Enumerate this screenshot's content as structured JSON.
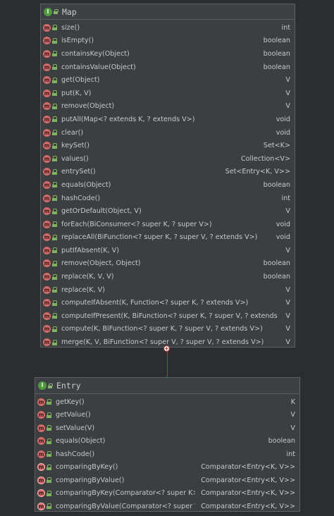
{
  "map": {
    "title": "Map",
    "header_icon": "I",
    "methods": [
      {
        "sig": "size()",
        "ret": "int"
      },
      {
        "sig": "isEmpty()",
        "ret": "boolean"
      },
      {
        "sig": "containsKey(Object)",
        "ret": "boolean"
      },
      {
        "sig": "containsValue(Object)",
        "ret": "boolean"
      },
      {
        "sig": "get(Object)",
        "ret": "V"
      },
      {
        "sig": "put(K, V)",
        "ret": "V"
      },
      {
        "sig": "remove(Object)",
        "ret": "V"
      },
      {
        "sig": "putAll(Map<? extends K, ? extends V>)",
        "ret": "void"
      },
      {
        "sig": "clear()",
        "ret": "void"
      },
      {
        "sig": "keySet()",
        "ret": "Set<K>"
      },
      {
        "sig": "values()",
        "ret": "Collection<V>"
      },
      {
        "sig": "entrySet()",
        "ret": "Set<Entry<K, V>>"
      },
      {
        "sig": "equals(Object)",
        "ret": "boolean"
      },
      {
        "sig": "hashCode()",
        "ret": "int"
      },
      {
        "sig": "getOrDefault(Object, V)",
        "ret": "V"
      },
      {
        "sig": "forEach(BiConsumer<? super K, ? super V>)",
        "ret": "void"
      },
      {
        "sig": "replaceAll(BiFunction<? super K, ? super V, ? extends V>)",
        "ret": "void"
      },
      {
        "sig": "putIfAbsent(K, V)",
        "ret": "V"
      },
      {
        "sig": "remove(Object, Object)",
        "ret": "boolean"
      },
      {
        "sig": "replace(K, V, V)",
        "ret": "boolean"
      },
      {
        "sig": "replace(K, V)",
        "ret": "V"
      },
      {
        "sig": "computeIfAbsent(K, Function<? super K, ? extends V>)",
        "ret": "V"
      },
      {
        "sig": "computeIfPresent(K, BiFunction<? super K, ? super V, ? extends V>)",
        "ret": "V"
      },
      {
        "sig": "compute(K, BiFunction<? super K, ? super V, ? extends V>)",
        "ret": "V"
      },
      {
        "sig": "merge(K, V, BiFunction<? super V, ? super V, ? extends V>)",
        "ret": "V"
      }
    ]
  },
  "entry": {
    "title": "Entry",
    "header_icon": "I",
    "methods": [
      {
        "sig": "getKey()",
        "ret": "K"
      },
      {
        "sig": "getValue()",
        "ret": "V"
      },
      {
        "sig": "setValue(V)",
        "ret": "V"
      },
      {
        "sig": "equals(Object)",
        "ret": "boolean"
      },
      {
        "sig": "hashCode()",
        "ret": "int"
      },
      {
        "sig": "comparingByKey()",
        "ret": "Comparator<Entry<K, V>>",
        "static": true
      },
      {
        "sig": "comparingByValue()",
        "ret": "Comparator<Entry<K, V>>",
        "static": true
      },
      {
        "sig": "comparingByKey(Comparator<? super K>)",
        "ret": "Comparator<Entry<K, V>>",
        "static": true
      },
      {
        "sig": "comparingByValue(Comparator<? super V>)",
        "ret": "Comparator<Entry<K, V>>",
        "static": true
      }
    ]
  },
  "method_icon": "m",
  "colors": {
    "background": "#2b2d30",
    "box_fill": "#3c3f41",
    "interface_icon": "#4f9a3f",
    "method_icon": "#d46b6b",
    "connector": "#b23c3c"
  }
}
